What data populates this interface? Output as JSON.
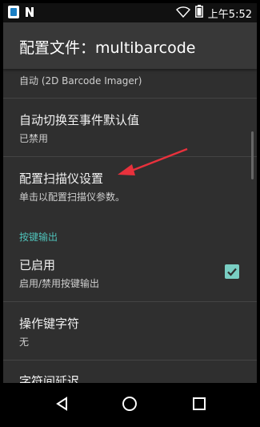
{
  "status_bar": {
    "time": "上午5:52",
    "left_icons": [
      "app-notification-icon",
      "n-notification-icon"
    ],
    "right_icons": [
      "wifi-icon",
      "battery-icon"
    ]
  },
  "app_bar": {
    "title": "配置文件：multibarcode"
  },
  "list": {
    "partial_top_item": {
      "summary": "自动 (2D Barcode Imager)"
    },
    "auto_switch": {
      "title": "自动切换至事件默认值",
      "summary": "已禁用"
    },
    "configure_scanner": {
      "title": "配置扫描仪设置",
      "summary": "单击以配置扫描仪参数。"
    },
    "section_keystroke": {
      "header": "按键输出"
    },
    "enabled": {
      "title": "已启用",
      "summary": "启用/禁用按键输出",
      "checked": true
    },
    "action_key_char": {
      "title": "操作键字符",
      "summary": "无"
    },
    "partial_bottom_item": {
      "title": "字符间延迟"
    }
  },
  "annotation": {
    "color": "#e8313c",
    "icon": "red-arrow-icon"
  },
  "colors": {
    "accent": "#79cec3",
    "section_header": "#4fc1b9",
    "background": "#2f2f2f"
  },
  "navbar": {
    "icons": [
      "back-icon",
      "home-icon",
      "recents-icon"
    ]
  }
}
